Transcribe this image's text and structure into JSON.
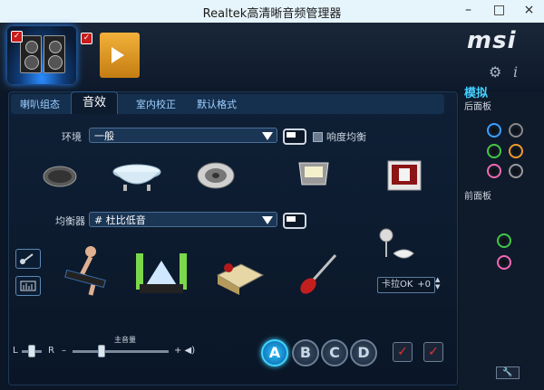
{
  "window": {
    "title": "Realtek高清晰音频管理器",
    "minimize": "–",
    "maximize": "□",
    "close": "×"
  },
  "brand": {
    "logo": "msi"
  },
  "tabs": [
    {
      "label": "喇叭组态"
    },
    {
      "label": "音效"
    },
    {
      "label": "室内校正"
    },
    {
      "label": "默认格式"
    }
  ],
  "environment": {
    "label": "环境",
    "value": "一般",
    "loudness_label": "响度均衡"
  },
  "equalizer": {
    "label": "均衡器",
    "value": "# 杜比低音"
  },
  "karaoke": {
    "label": "卡拉OK",
    "value": "+0"
  },
  "volume": {
    "left": "L",
    "right": "R",
    "main_label": "主音量",
    "minus": "–",
    "plus": "+ ◀)"
  },
  "presets": [
    "A",
    "B",
    "C",
    "D"
  ],
  "right_panel": {
    "title": "模拟",
    "rear": "后面板",
    "front": "前面板"
  },
  "icons": {
    "speaker_device": "speaker-device-icon",
    "headphone_device": "music-player-device-icon",
    "settings": "gear-icon",
    "info": "info-icon",
    "wrench": "wrench-icon"
  },
  "colors": {
    "accent": "#3fd4ff",
    "panel_bg": "#0b1626"
  }
}
